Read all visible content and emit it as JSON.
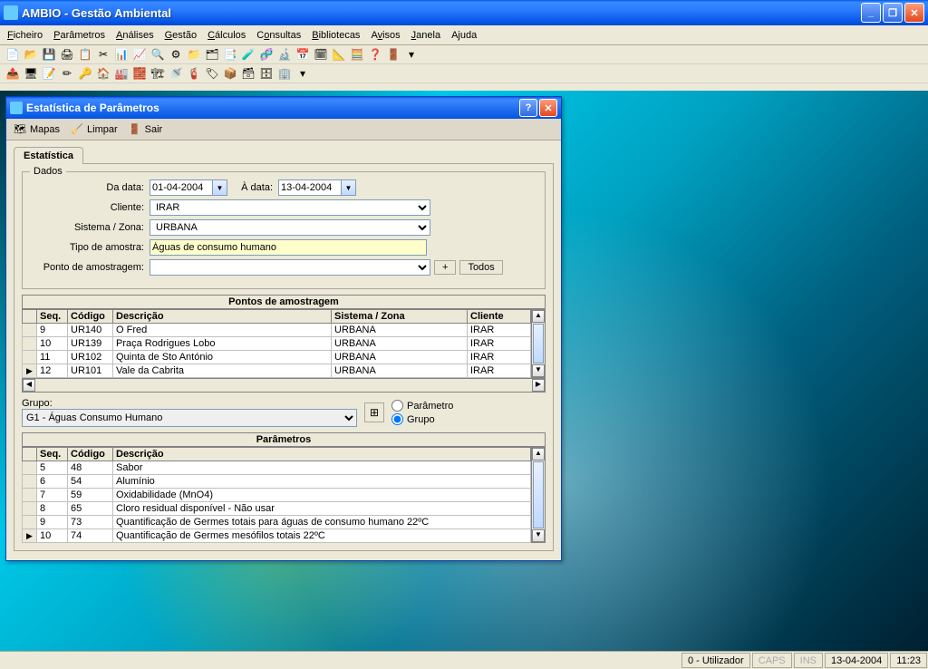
{
  "app": {
    "title": "AMBIO - Gestão Ambiental"
  },
  "menu": {
    "ficheiro": "Ficheiro",
    "parametros": "Parâmetros",
    "analises": "Análises",
    "gestao": "Gestão",
    "calculos": "Cálculos",
    "consultas": "Consultas",
    "bibliotecas": "Bibliotecas",
    "avisos": "Avisos",
    "janela": "Janela",
    "ajuda": "Ajuda"
  },
  "dialog": {
    "title": "Estatística de Parâmetros",
    "toolbar": {
      "mapas": "Mapas",
      "limpar": "Limpar",
      "sair": "Sair"
    },
    "tab": "Estatística",
    "dados_legend": "Dados",
    "labels": {
      "da_data": "Da data:",
      "a_data": "À data:",
      "cliente": "Cliente:",
      "sistema": "Sistema / Zona:",
      "tipo_amostra": "Tipo de amostra:",
      "ponto_amost": "Ponto de amostragem:",
      "grupo": "Grupo:"
    },
    "values": {
      "da_data": "01-04-2004",
      "a_data": "13-04-2004",
      "cliente": "IRAR",
      "sistema": "URBANA",
      "tipo_amostra": "Águas de consumo humano",
      "ponto_amost": "",
      "grupo": "G1 - Águas Consumo Humano"
    },
    "buttons": {
      "plus": "+",
      "todos": "Todos"
    },
    "radios": {
      "parametro": "Parâmetro",
      "grupo": "Grupo"
    },
    "pontos_title": "Pontos de amostragem",
    "pontos_cols": {
      "seq": "Seq.",
      "codigo": "Código",
      "descricao": "Descrição",
      "sistema": "Sistema / Zona",
      "cliente": "Cliente"
    },
    "pontos_rows": [
      {
        "sel": "",
        "seq": "9",
        "cod": "UR140",
        "desc": "O Fred",
        "sis": "URBANA",
        "cli": "IRAR"
      },
      {
        "sel": "",
        "seq": "10",
        "cod": "UR139",
        "desc": "Praça Rodrigues Lobo",
        "sis": "URBANA",
        "cli": "IRAR"
      },
      {
        "sel": "",
        "seq": "11",
        "cod": "UR102",
        "desc": "Quinta de Sto António",
        "sis": "URBANA",
        "cli": "IRAR"
      },
      {
        "sel": "▶",
        "seq": "12",
        "cod": "UR101",
        "desc": "Vale da Cabrita",
        "sis": "URBANA",
        "cli": "IRAR"
      }
    ],
    "param_title": "Parâmetros",
    "param_cols": {
      "seq": "Seq.",
      "codigo": "Código",
      "descricao": "Descrição"
    },
    "param_rows": [
      {
        "sel": "",
        "seq": "5",
        "cod": "48",
        "desc": "Sabor"
      },
      {
        "sel": "",
        "seq": "6",
        "cod": "54",
        "desc": "Alumínio"
      },
      {
        "sel": "",
        "seq": "7",
        "cod": "59",
        "desc": "Oxidabilidade (MnO4)"
      },
      {
        "sel": "",
        "seq": "8",
        "cod": "65",
        "desc": "Cloro residual disponível - Não usar"
      },
      {
        "sel": "",
        "seq": "9",
        "cod": "73",
        "desc": "Quantificação de Germes totais para águas de consumo humano 22ºC"
      },
      {
        "sel": "▶",
        "seq": "10",
        "cod": "74",
        "desc": "Quantificação de Germes mesófilos totais 22ºC"
      }
    ]
  },
  "status": {
    "user": "0 - Utilizador",
    "caps": "CAPS",
    "ins": "INS",
    "date": "13-04-2004",
    "time": "11:23"
  }
}
